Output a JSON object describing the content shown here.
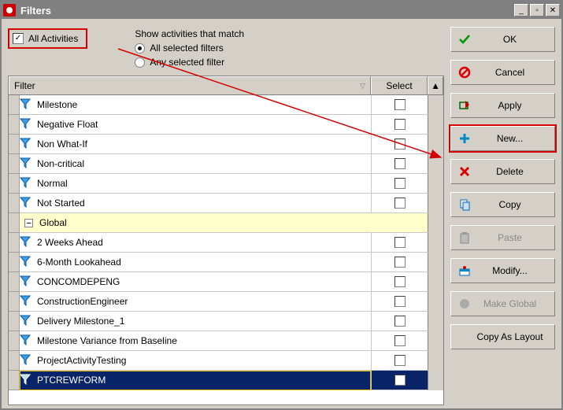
{
  "window": {
    "title": "Filters"
  },
  "options": {
    "all_activities_label": "All Activities",
    "all_activities_checked": true,
    "match_label": "Show activities that match",
    "radio_all": "All selected filters",
    "radio_any": "Any selected filter",
    "selected_radio": "all"
  },
  "columns": {
    "filter": "Filter",
    "select": "Select"
  },
  "groups": [
    {
      "name": "",
      "expanded": true,
      "items": [
        {
          "label": "Milestone",
          "checked": false
        },
        {
          "label": "Negative Float",
          "checked": false
        },
        {
          "label": "Non What-If",
          "checked": false
        },
        {
          "label": "Non-critical",
          "checked": false
        },
        {
          "label": "Normal",
          "checked": false
        },
        {
          "label": "Not Started",
          "checked": false
        }
      ]
    },
    {
      "name": "Global",
      "expanded": true,
      "items": [
        {
          "label": "2 Weeks Ahead",
          "checked": false
        },
        {
          "label": "6-Month Lookahead",
          "checked": false
        },
        {
          "label": "CONCOMDEPENG",
          "checked": false
        },
        {
          "label": "ConstructionEngineer",
          "checked": false
        },
        {
          "label": "Delivery Milestone_1",
          "checked": false
        },
        {
          "label": "Milestone Variance from Baseline",
          "checked": false
        },
        {
          "label": "ProjectActivityTesting",
          "checked": false
        },
        {
          "label": "PTCREWFORM",
          "checked": false,
          "selected": true
        }
      ]
    }
  ],
  "buttons": {
    "ok": "OK",
    "cancel": "Cancel",
    "apply": "Apply",
    "new": "New...",
    "delete": "Delete",
    "copy": "Copy",
    "paste": "Paste",
    "modify": "Modify...",
    "make_global": "Make Global",
    "copy_as_layout": "Copy As Layout"
  }
}
